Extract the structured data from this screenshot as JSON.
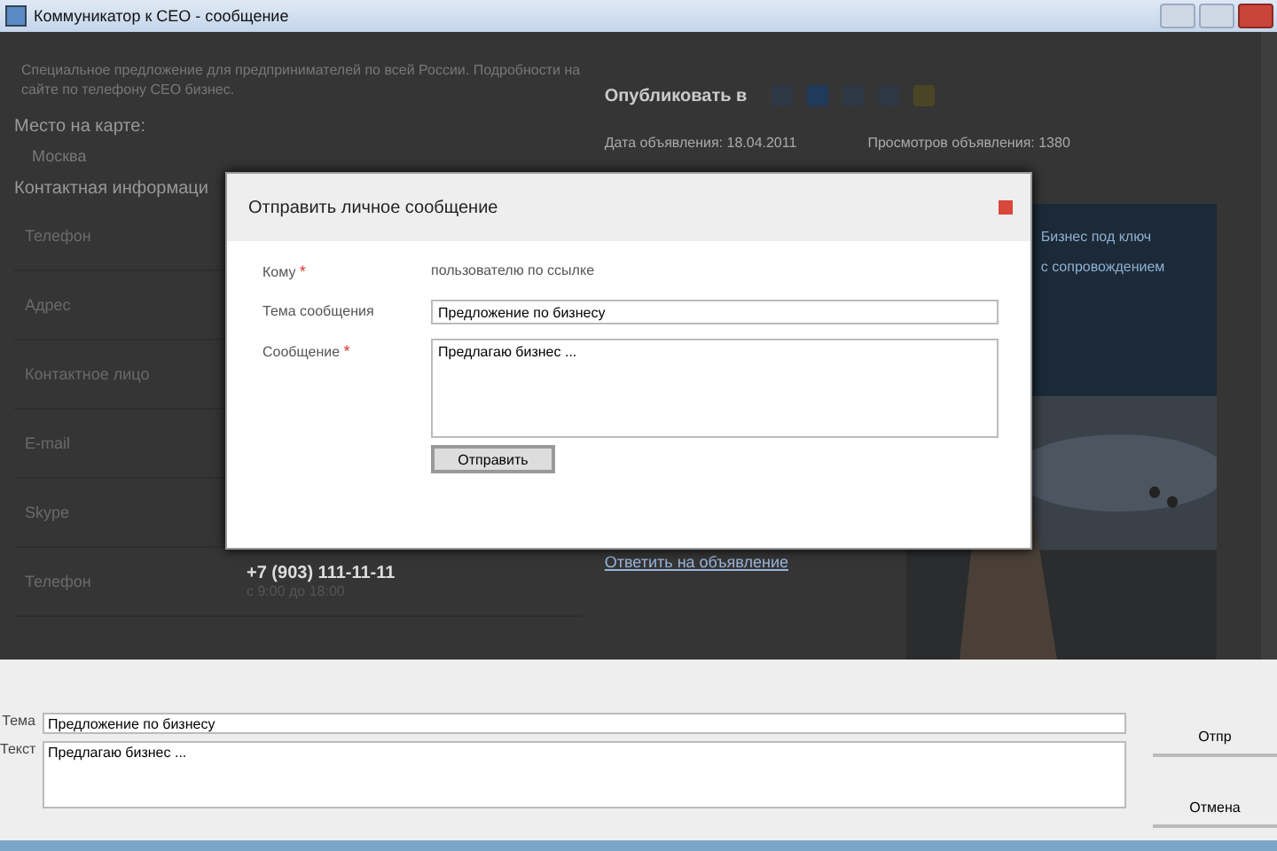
{
  "window": {
    "title": "Коммуникатор к СЕО - сообщение"
  },
  "page": {
    "intro": "Специальное предложение для предпринимателей по всей России. Подробности на сайте по телефону СЕО бизнес.",
    "share_label": "Опубликовать в",
    "map_heading": "Место на карте:",
    "city": "Москва",
    "contact_heading": "Контактная информаци",
    "date": "Дата объявления: 18.04.2011",
    "views": "Просмотров объявления: 1380",
    "rows": [
      {
        "label": "Телефон"
      },
      {
        "label": "Адрес"
      },
      {
        "label": "Контактное лицо"
      },
      {
        "label": "E-mail"
      },
      {
        "label": "Skype"
      },
      {
        "label": "Телефон",
        "value": "+7 (903) 111-11-11",
        "note": "с 9:00 до 18:00"
      }
    ],
    "banner": {
      "line_1": "Бизнес под ключ",
      "line_2": "с сопровождением"
    },
    "reply_link": "Ответить на объявление"
  },
  "dialog": {
    "title": "Отправить личное сообщение",
    "to_label": "Кому",
    "to_mark": "*",
    "message_mark": "*",
    "to_value": "пользователю по ссылке",
    "subject_label": "Тема сообщения",
    "subject_value": "Предложение по бизнесу",
    "message_label": "Сообщение",
    "message_value": "Предлагаю бизнес ...",
    "send": "Отправить"
  },
  "composer": {
    "subject_label": "Тема",
    "subject_value": "Предложение по бизнесу",
    "text_label": "Текст",
    "text_value": "Предлагаю бизнес ...",
    "buttons": [
      "Отпр",
      "Отмена"
    ]
  }
}
